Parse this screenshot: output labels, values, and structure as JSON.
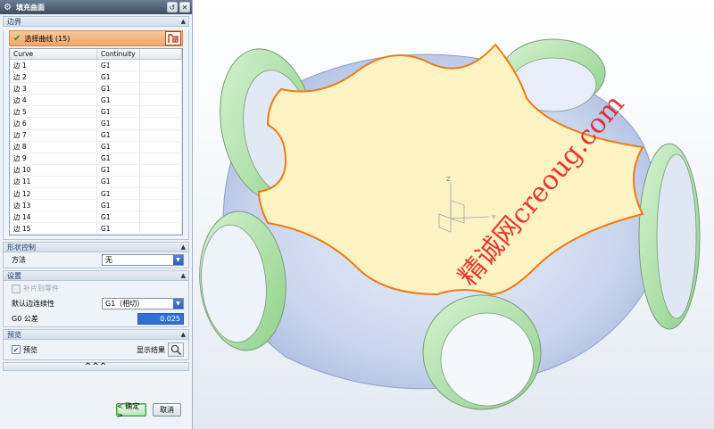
{
  "dialog": {
    "title": "填充曲面",
    "title_buttons": {
      "reset": "↺",
      "close": "✕"
    }
  },
  "boundary": {
    "header": "边界",
    "select_label": "选择曲线 (15)",
    "columns": {
      "curve": "Curve",
      "continuity": "Continuity"
    },
    "rows": [
      {
        "curve": "边 1",
        "continuity": "G1"
      },
      {
        "curve": "边 2",
        "continuity": "G1"
      },
      {
        "curve": "边 3",
        "continuity": "G1"
      },
      {
        "curve": "边 4",
        "continuity": "G1"
      },
      {
        "curve": "边 5",
        "continuity": "G1"
      },
      {
        "curve": "边 6",
        "continuity": "G1"
      },
      {
        "curve": "边 7",
        "continuity": "G1"
      },
      {
        "curve": "边 8",
        "continuity": "G1"
      },
      {
        "curve": "边 9",
        "continuity": "G1"
      },
      {
        "curve": "边 10",
        "continuity": "G1"
      },
      {
        "curve": "边 11",
        "continuity": "G1"
      },
      {
        "curve": "边 12",
        "continuity": "G1"
      },
      {
        "curve": "边 13",
        "continuity": "G1"
      },
      {
        "curve": "边 14",
        "continuity": "G1"
      },
      {
        "curve": "边 15",
        "continuity": "G1"
      }
    ]
  },
  "shape_control": {
    "header": "形状控制",
    "method_label": "方法",
    "method_value": "无"
  },
  "settings": {
    "header": "设置",
    "patch_label": "补片到零件",
    "default_continuity_label": "默认边连续性",
    "default_continuity_value": "G1（相切）",
    "g0_label": "G0 公差",
    "g0_value": "0.025"
  },
  "preview": {
    "header": "预览",
    "preview_label": "预览",
    "show_result_label": "显示结果"
  },
  "buttons": {
    "more": "^^^",
    "ok": "< 确定 >",
    "cancel": "取消"
  },
  "viewport": {
    "watermark": "精诚网creoug.com",
    "axis_y": "Y",
    "axis_z": "Z",
    "colors": {
      "fill": "#fdf3c2",
      "boundary": "#f07a14",
      "rings": "#a9e3a6",
      "body": "#c7d4ee"
    }
  }
}
